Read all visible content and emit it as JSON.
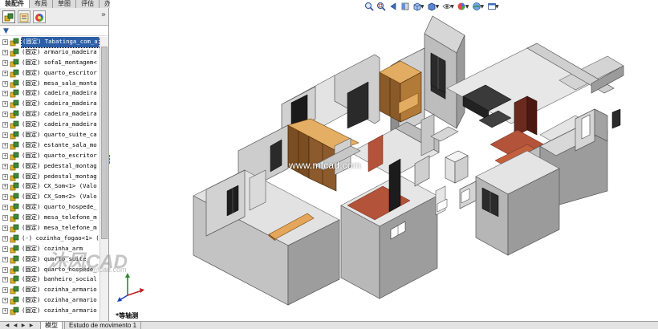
{
  "command_manager": {
    "tabs": [
      "装配件",
      "布局",
      "草图",
      "评估",
      "办公室产品"
    ]
  },
  "feature_manager": {
    "more_symbol": "»",
    "tree_items": [
      "(固定) Tabatinga_com_a",
      "(固定) armario_madeira",
      "(固定) sofa1_montagem<",
      "(固定) quarto_escritor",
      "(固定) mesa_sala_monta",
      "(固定) cadeira_madeira",
      "(固定) cadeira_madeira",
      "(固定) cadeira_madeira",
      "(固定) cadeira_madeira",
      "(固定) quarto_suite_ca",
      "(固定) estante_sala_mo",
      "(固定) quarto_escritor",
      "(固定) pedestal_montag",
      "(固定) pedestal_montag",
      "(固定) CX_Som<1> (Valo",
      "(固定) CX_Som<2> (Valo",
      "(固定) quarto_hospede_",
      "(固定) mesa_telefone_m",
      "(固定) mesa_telefone_m",
      "(-) cozinha_fogao<1> (",
      "(固定) cozinha_arm",
      "(固定) quarto_suite_",
      "(固定) quarto_hospede_",
      "(固定) banheiro_social",
      "(固定) cozinha_armario",
      "(固定) cozinha_armario",
      "(固定) cozinha_armario"
    ]
  },
  "graphics": {
    "watermark_url": "www.mfcad.com",
    "watermark_logo": "沐风CAD",
    "watermark_logo_sub": "www.mfcad.com",
    "view_orientation": "*等轴测",
    "triad_axes": [
      "x",
      "y",
      "z"
    ]
  },
  "bottom_tabs": [
    "模型",
    "Estudo de movimento 1"
  ],
  "heads_up_icons": [
    "zoom-to-fit-icon",
    "zoom-area-icon",
    "previous-view-icon",
    "section-view-icon",
    "view-orientation-icon",
    "display-style-icon",
    "hide-show-items-icon",
    "edit-appearance-icon",
    "apply-scene-icon",
    "view-settings-icon"
  ],
  "colors": {
    "selection": "#2c5fa8",
    "wall_light": "#cfcfcf",
    "wall_dark": "#8f8f8f",
    "floor": "#e8e8e8",
    "wood": "#d9a25a",
    "brick": "#b3533a"
  }
}
